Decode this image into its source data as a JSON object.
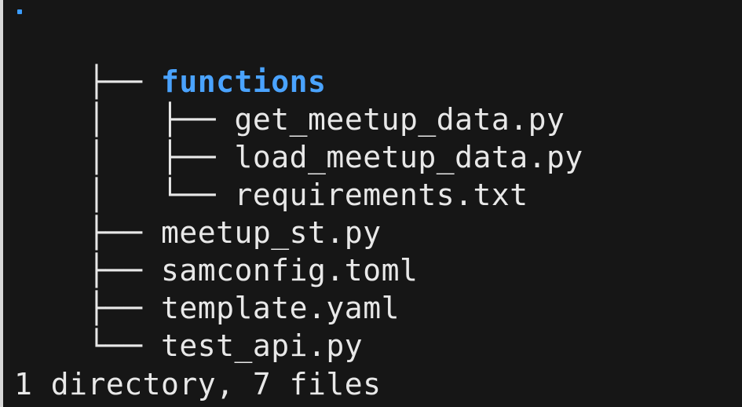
{
  "terminal": {
    "root": ".",
    "lines": [
      {
        "prefix": "├── ",
        "name": "functions",
        "type": "directory"
      },
      {
        "prefix": "│   ├── ",
        "name": "get_meetup_data.py",
        "type": "file"
      },
      {
        "prefix": "│   ├── ",
        "name": "load_meetup_data.py",
        "type": "file"
      },
      {
        "prefix": "│   └── ",
        "name": "requirements.txt",
        "type": "file"
      },
      {
        "prefix": "├── ",
        "name": "meetup_st.py",
        "type": "file"
      },
      {
        "prefix": "├── ",
        "name": "samconfig.toml",
        "type": "file"
      },
      {
        "prefix": "├── ",
        "name": "template.yaml",
        "type": "file"
      },
      {
        "prefix": "└── ",
        "name": "test_api.py",
        "type": "file"
      }
    ],
    "summary": "1 directory, 7 files",
    "colors": {
      "background": "#161616",
      "text": "#e8e8e8",
      "directory": "#4aa3ff",
      "root": "#3b9cff"
    }
  }
}
